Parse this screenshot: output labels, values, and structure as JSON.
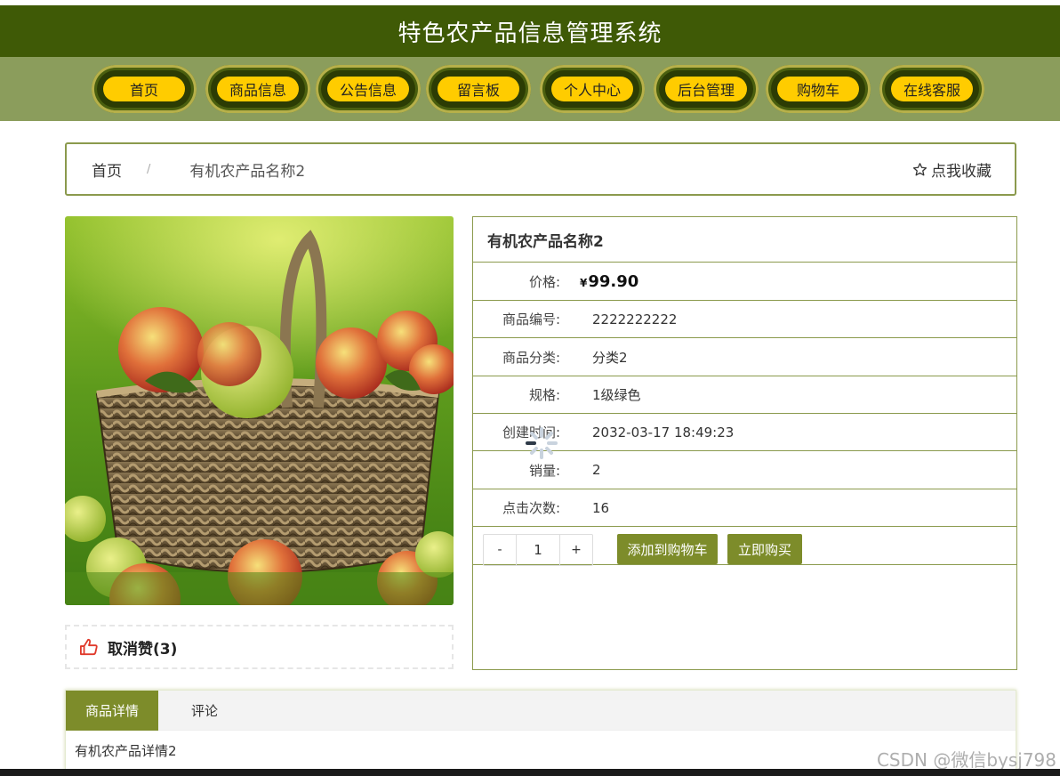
{
  "header": {
    "title": "特色农产品信息管理系统"
  },
  "nav": {
    "items": [
      {
        "label": "首页"
      },
      {
        "label": "商品信息"
      },
      {
        "label": "公告信息"
      },
      {
        "label": "留言板"
      },
      {
        "label": "个人中心"
      },
      {
        "label": "后台管理"
      },
      {
        "label": "购物车"
      },
      {
        "label": "在线客服"
      }
    ]
  },
  "breadcrumb": {
    "home": "首页",
    "separator": "/",
    "current": "有机农产品名称2",
    "favorite": "点我收藏"
  },
  "product": {
    "name": "有机农产品名称2",
    "image_icon": "apple-basket-photo",
    "like_label": "取消赞(3)",
    "price_label": "价格:",
    "currency": "¥",
    "price": "99.90",
    "fields": [
      {
        "label": "商品编号:",
        "value": "2222222222"
      },
      {
        "label": "商品分类:",
        "value": "分类2"
      },
      {
        "label": "规格:",
        "value": "1级绿色"
      },
      {
        "label": "创建时间:",
        "value": "2032-03-17 18:49:23"
      },
      {
        "label": "销量:",
        "value": "2"
      },
      {
        "label": "点击次数:",
        "value": "16"
      }
    ],
    "quantity": "1",
    "minus": "-",
    "plus": "+",
    "add_to_cart": "添加到购物车",
    "buy_now": "立即购买"
  },
  "tabs": {
    "items": [
      {
        "label": "商品详情",
        "active": true
      },
      {
        "label": "评论",
        "active": false
      }
    ],
    "detail_text": "有机农产品详情2"
  },
  "watermark": "CSDN @微信bysj798",
  "colors": {
    "header": "#3f5a06",
    "nav": "#8b9d5c",
    "pill": "#ffcc00",
    "accent": "#7d8c2a",
    "border": "#8b9a4d"
  }
}
